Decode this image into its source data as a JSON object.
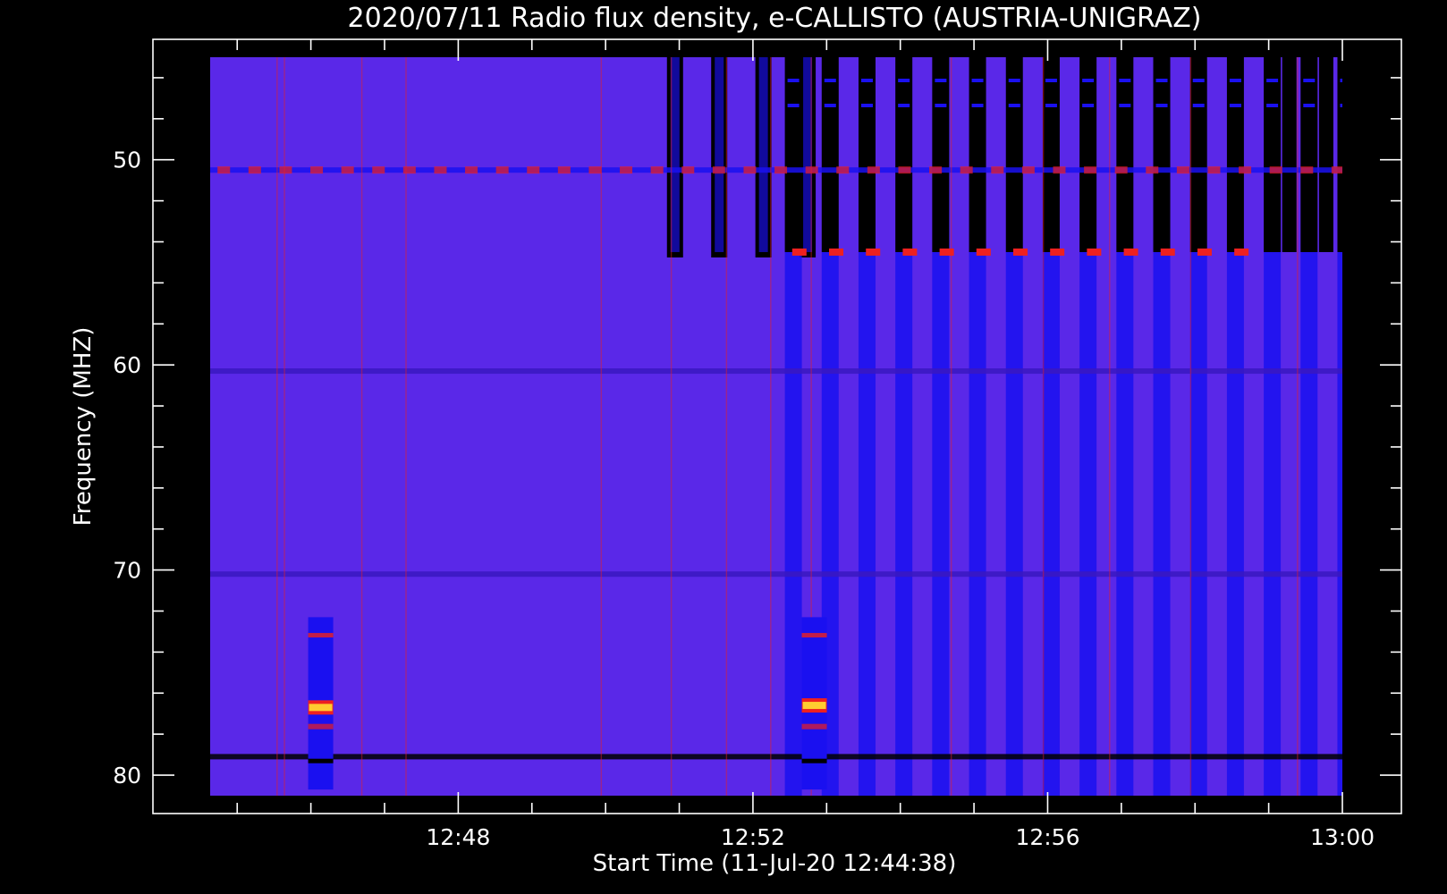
{
  "chart_data": {
    "type": "heatmap",
    "title": "2020/07/11  Radio flux density, e-CALLISTO (AUSTRIA-UNIGRAZ)",
    "xlabel": "Start Time (11-Jul-20 12:44:38)",
    "ylabel": "Frequency (MHZ)",
    "x_axis": {
      "start": "12:44:38",
      "end": "13:00:00",
      "range_minutes": [
        0,
        15.367
      ],
      "ticks": [
        {
          "label": "12:48",
          "minutes": 3.367
        },
        {
          "label": "12:52",
          "minutes": 7.367
        },
        {
          "label": "12:56",
          "minutes": 11.367
        },
        {
          "label": "13:00",
          "minutes": 15.367
        }
      ],
      "minor_tick_minutes": 1
    },
    "y_axis": {
      "range": [
        45,
        81
      ],
      "inverted": true,
      "ticks": [
        {
          "label": "50",
          "value": 50
        },
        {
          "label": "60",
          "value": 60
        },
        {
          "label": "70",
          "value": 70
        },
        {
          "label": "80",
          "value": 80
        }
      ],
      "minor_tick_step": 2
    },
    "colormap": {
      "background": "#5a28e8",
      "low": "#000000",
      "mid": "#1a10f0",
      "high": "#ee2020",
      "peak": "#ffcc30"
    },
    "features": {
      "horizontal_bands_mhz": [
        50.5,
        54.5,
        60.3,
        70.2,
        79.1
      ],
      "switching_period_minutes": 0.5,
      "noise_stripes_start_minutes": 7.8,
      "burst_points": [
        {
          "minutes": 1.5,
          "freq_mhz": 76.7,
          "intensity": "peak"
        },
        {
          "minutes": 8.2,
          "freq_mhz": 76.6,
          "intensity": "peak"
        }
      ]
    }
  }
}
